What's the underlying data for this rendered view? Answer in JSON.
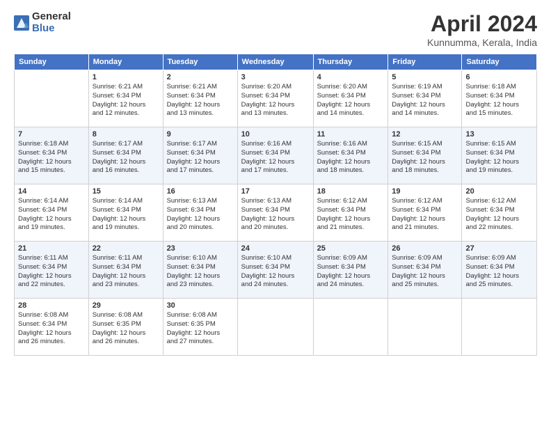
{
  "logo": {
    "general": "General",
    "blue": "Blue"
  },
  "title": "April 2024",
  "subtitle": "Kunnumma, Kerala, India",
  "days_of_week": [
    "Sunday",
    "Monday",
    "Tuesday",
    "Wednesday",
    "Thursday",
    "Friday",
    "Saturday"
  ],
  "weeks": [
    [
      {
        "day": "",
        "info": ""
      },
      {
        "day": "1",
        "info": "Sunrise: 6:21 AM\nSunset: 6:34 PM\nDaylight: 12 hours\nand 12 minutes."
      },
      {
        "day": "2",
        "info": "Sunrise: 6:21 AM\nSunset: 6:34 PM\nDaylight: 12 hours\nand 13 minutes."
      },
      {
        "day": "3",
        "info": "Sunrise: 6:20 AM\nSunset: 6:34 PM\nDaylight: 12 hours\nand 13 minutes."
      },
      {
        "day": "4",
        "info": "Sunrise: 6:20 AM\nSunset: 6:34 PM\nDaylight: 12 hours\nand 14 minutes."
      },
      {
        "day": "5",
        "info": "Sunrise: 6:19 AM\nSunset: 6:34 PM\nDaylight: 12 hours\nand 14 minutes."
      },
      {
        "day": "6",
        "info": "Sunrise: 6:18 AM\nSunset: 6:34 PM\nDaylight: 12 hours\nand 15 minutes."
      }
    ],
    [
      {
        "day": "7",
        "info": "Sunrise: 6:18 AM\nSunset: 6:34 PM\nDaylight: 12 hours\nand 15 minutes."
      },
      {
        "day": "8",
        "info": "Sunrise: 6:17 AM\nSunset: 6:34 PM\nDaylight: 12 hours\nand 16 minutes."
      },
      {
        "day": "9",
        "info": "Sunrise: 6:17 AM\nSunset: 6:34 PM\nDaylight: 12 hours\nand 17 minutes."
      },
      {
        "day": "10",
        "info": "Sunrise: 6:16 AM\nSunset: 6:34 PM\nDaylight: 12 hours\nand 17 minutes."
      },
      {
        "day": "11",
        "info": "Sunrise: 6:16 AM\nSunset: 6:34 PM\nDaylight: 12 hours\nand 18 minutes."
      },
      {
        "day": "12",
        "info": "Sunrise: 6:15 AM\nSunset: 6:34 PM\nDaylight: 12 hours\nand 18 minutes."
      },
      {
        "day": "13",
        "info": "Sunrise: 6:15 AM\nSunset: 6:34 PM\nDaylight: 12 hours\nand 19 minutes."
      }
    ],
    [
      {
        "day": "14",
        "info": "Sunrise: 6:14 AM\nSunset: 6:34 PM\nDaylight: 12 hours\nand 19 minutes."
      },
      {
        "day": "15",
        "info": "Sunrise: 6:14 AM\nSunset: 6:34 PM\nDaylight: 12 hours\nand 19 minutes."
      },
      {
        "day": "16",
        "info": "Sunrise: 6:13 AM\nSunset: 6:34 PM\nDaylight: 12 hours\nand 20 minutes."
      },
      {
        "day": "17",
        "info": "Sunrise: 6:13 AM\nSunset: 6:34 PM\nDaylight: 12 hours\nand 20 minutes."
      },
      {
        "day": "18",
        "info": "Sunrise: 6:12 AM\nSunset: 6:34 PM\nDaylight: 12 hours\nand 21 minutes."
      },
      {
        "day": "19",
        "info": "Sunrise: 6:12 AM\nSunset: 6:34 PM\nDaylight: 12 hours\nand 21 minutes."
      },
      {
        "day": "20",
        "info": "Sunrise: 6:12 AM\nSunset: 6:34 PM\nDaylight: 12 hours\nand 22 minutes."
      }
    ],
    [
      {
        "day": "21",
        "info": "Sunrise: 6:11 AM\nSunset: 6:34 PM\nDaylight: 12 hours\nand 22 minutes."
      },
      {
        "day": "22",
        "info": "Sunrise: 6:11 AM\nSunset: 6:34 PM\nDaylight: 12 hours\nand 23 minutes."
      },
      {
        "day": "23",
        "info": "Sunrise: 6:10 AM\nSunset: 6:34 PM\nDaylight: 12 hours\nand 23 minutes."
      },
      {
        "day": "24",
        "info": "Sunrise: 6:10 AM\nSunset: 6:34 PM\nDaylight: 12 hours\nand 24 minutes."
      },
      {
        "day": "25",
        "info": "Sunrise: 6:09 AM\nSunset: 6:34 PM\nDaylight: 12 hours\nand 24 minutes."
      },
      {
        "day": "26",
        "info": "Sunrise: 6:09 AM\nSunset: 6:34 PM\nDaylight: 12 hours\nand 25 minutes."
      },
      {
        "day": "27",
        "info": "Sunrise: 6:09 AM\nSunset: 6:34 PM\nDaylight: 12 hours\nand 25 minutes."
      }
    ],
    [
      {
        "day": "28",
        "info": "Sunrise: 6:08 AM\nSunset: 6:34 PM\nDaylight: 12 hours\nand 26 minutes."
      },
      {
        "day": "29",
        "info": "Sunrise: 6:08 AM\nSunset: 6:35 PM\nDaylight: 12 hours\nand 26 minutes."
      },
      {
        "day": "30",
        "info": "Sunrise: 6:08 AM\nSunset: 6:35 PM\nDaylight: 12 hours\nand 27 minutes."
      },
      {
        "day": "",
        "info": ""
      },
      {
        "day": "",
        "info": ""
      },
      {
        "day": "",
        "info": ""
      },
      {
        "day": "",
        "info": ""
      }
    ]
  ]
}
